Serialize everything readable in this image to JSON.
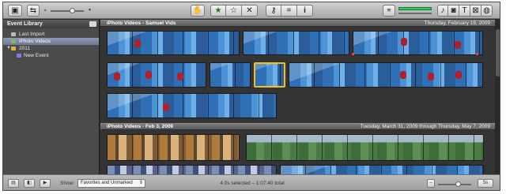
{
  "toolbar": {
    "import_icon": "camera-import-icon",
    "swap_icon": "swap-library-icon",
    "favorite_glyph": "★",
    "unmark_glyph": "☆",
    "reject_glyph": "✕",
    "info_glyph": "i"
  },
  "sidebar": {
    "header": "Event Library",
    "items": [
      {
        "label": "Last Import"
      },
      {
        "label": "iPhoto Videos"
      },
      {
        "label": "2011"
      },
      {
        "label": "New Event"
      }
    ]
  },
  "events": [
    {
      "title": "iPhoto Videos - Samuel Vids",
      "date": "Thursday, February 19, 2009"
    },
    {
      "title": "iPhoto Videos - Feb 3, 2009",
      "date": "Tuesday, March 31, 2009 through Thursday, May 7, 2009"
    }
  ],
  "bottombar": {
    "show_label": "Show:",
    "filter_value": "Favorites and Unmarked",
    "status": "4.0s selected – 1:07:40 total",
    "duration": "5s"
  },
  "colors": {
    "selection": "#f2c21c",
    "sidebar_selected": "#7a86a2",
    "level_meter": "#2fd05a"
  }
}
